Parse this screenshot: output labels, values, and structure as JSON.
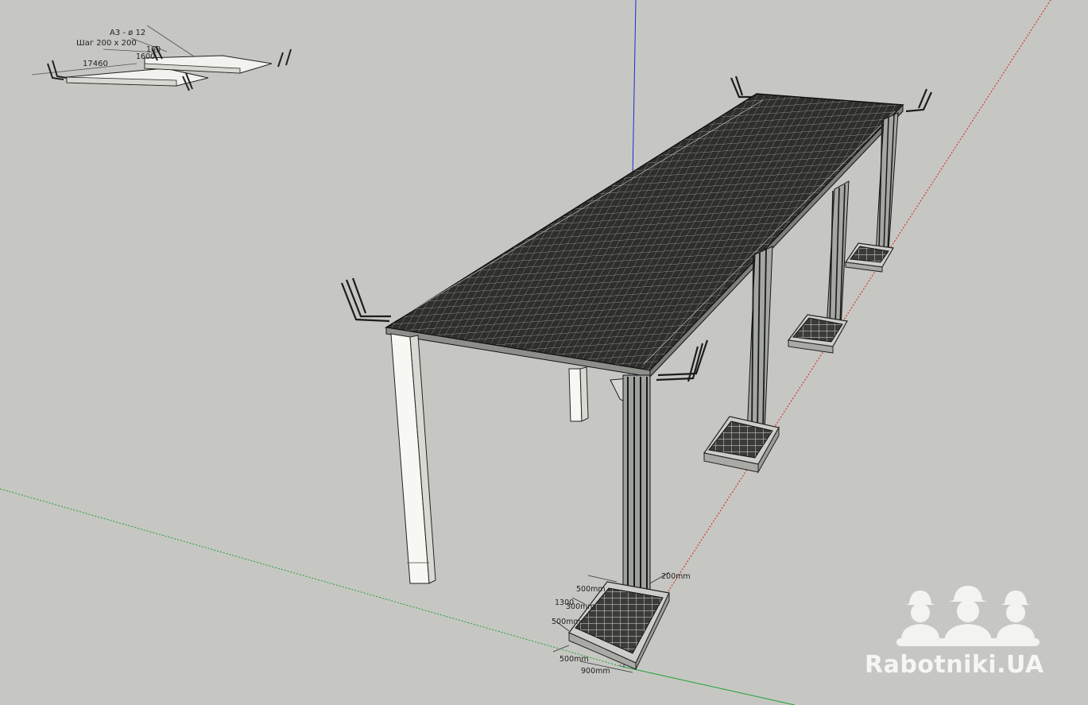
{
  "app": {
    "background_color": "#c6c7c2",
    "axis_colors": {
      "blue": "#1a2bd6",
      "red": "#d81c1c",
      "green": "#1fa03a"
    }
  },
  "drawing": {
    "reference_labels": {
      "rebar": "А3 - ø 12",
      "pitch": "Шаг 200 х 200",
      "width_a": "160",
      "width_b": "1600",
      "length": "17460"
    },
    "footing_dimensions": {
      "column": "200mm",
      "top_a": "500mm",
      "height": "1300",
      "inner": "300mm",
      "side": "500mm",
      "bottom_a": "500mm",
      "bottom_b": "900mm"
    }
  },
  "watermark": {
    "brand": "Rabotniki.UA",
    "icon": "workers-helmets-icon"
  }
}
